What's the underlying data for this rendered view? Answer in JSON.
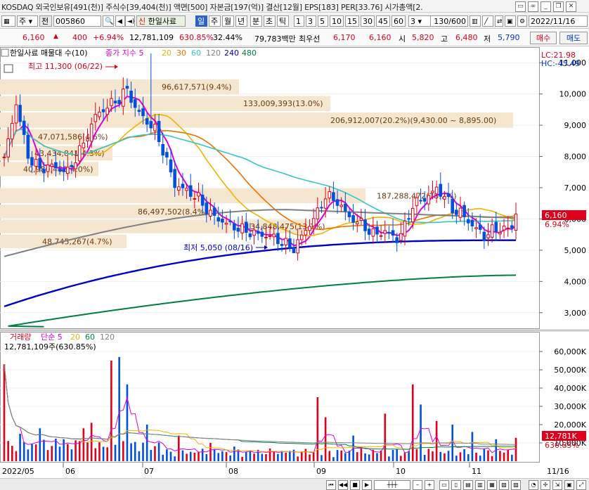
{
  "info_bar": {
    "text": "KOSDAQ 외국인보유[491(천)] 주식수[39,404(천)] 액면[500] 자본금[197(억)] 결산[12월] EPS[183] PER[33.76] 시가총액[2.",
    "icons": [
      "window-icon",
      "lock-icon",
      "minimize-icon",
      "restore-icon",
      "close-icon"
    ]
  },
  "toolbar": {
    "menu_label": "주",
    "prev_label": "전",
    "code": "005860",
    "name": "한일사료",
    "name_prefix": "신",
    "periods": [
      "일",
      "주",
      "월",
      "년",
      "분",
      "초",
      "틱"
    ],
    "selected_period": "일",
    "intervals": [
      "1",
      "3",
      "5",
      "10",
      "15",
      "30",
      "45",
      "60"
    ],
    "interval_value": "3",
    "count": "130",
    "count_total": "/600",
    "date": "2022/11/16"
  },
  "quote": {
    "price": "6,160",
    "change": "400",
    "change_pct": "+6.94%",
    "volume": "12,781,109",
    "volume_ratio": "630.85%",
    "turnover": "32.44%",
    "trade_value": "79,783백만",
    "best_bid_label": "최우선",
    "best_ask": "6,170",
    "best_bid": "6,160",
    "open_label": "시",
    "open": "5,820",
    "high_label": "고",
    "high": "6,480",
    "low_label": "저",
    "low": "5,790",
    "buy_label": "매수",
    "sell_label": "매도"
  },
  "price_panel": {
    "title": "한일사료 매물대 수(10)",
    "ma_label": "종가 지수 5",
    "ma_periods": [
      "20",
      "30",
      "60",
      "120",
      "240",
      "480"
    ],
    "ma_colors": [
      "#e100e1",
      "#f0b400",
      "#f07000",
      "#33c8c8",
      "#808080",
      "#0000cc",
      "#008040"
    ],
    "lc_label": "LC:21.98",
    "hc_label": "HC:-45.49",
    "high_annotation": "최고 11,300 (06/22)",
    "low_annotation": "최저 5,050 (08/16)",
    "last_price": "6,160",
    "last_pct": "6.94%",
    "y_ticks": [
      "11,000",
      "10,000",
      "9,000",
      "8,000",
      "7,000",
      "6,000",
      "5,000",
      "4,000",
      "3,000"
    ],
    "volume_profile": [
      {
        "label": "96,617,571(9.4%)"
      },
      {
        "label": "133,009,393(13.0%)"
      },
      {
        "label": "206,912,007(20.2%)(9,430.00 ~ 8,895.00)"
      },
      {
        "label": "47,071,586(4.6%)"
      },
      {
        "label": "43,434,841(4.3%)"
      },
      {
        "label": "40,980,488(4.0%)"
      },
      {
        "label": "187,288,472(18.2%)"
      },
      {
        "label": "86,497,502(8.4%)"
      },
      {
        "label": "134,848,475(13.1%)"
      },
      {
        "label": "48,745,267(4.7%)"
      }
    ]
  },
  "volume_panel": {
    "title": "거래량",
    "ma_label": "단순 5",
    "ma_periods": [
      "20",
      "60",
      "120"
    ],
    "ma_colors": [
      "#e100e1",
      "#f0b400",
      "#008040",
      "#808080"
    ],
    "current": "12,781,109주(630.85%)",
    "last_volume": "12,781K",
    "last_pct": "630.85%",
    "y_ticks": [
      "60,000K",
      "50,000K",
      "40,000K",
      "30,000K",
      "20,000K",
      "10,000K"
    ]
  },
  "x_axis": {
    "labels": [
      "2022/05",
      "06",
      "07",
      "08",
      "09",
      "10",
      "11"
    ],
    "right_label": "11/16"
  },
  "chart_data": {
    "type": "candlestick",
    "price_range": [
      2500,
      11500
    ],
    "volume_range": [
      0,
      65000
    ],
    "volume_unit": "K",
    "moving_averages": [
      "5",
      "20",
      "30",
      "60",
      "120",
      "240",
      "480"
    ],
    "last_close": 6160,
    "recent_high": {
      "value": 11300,
      "date": "06/22"
    },
    "recent_low": {
      "value": 5050,
      "date": "08/16"
    }
  }
}
